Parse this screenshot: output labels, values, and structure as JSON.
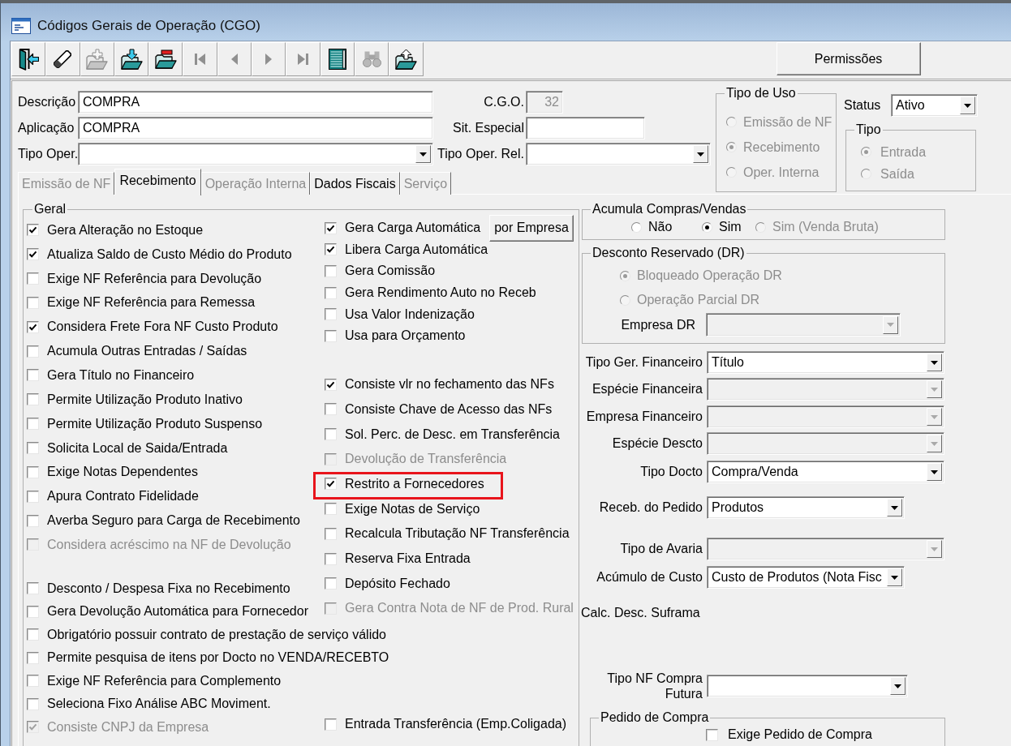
{
  "window": {
    "title": "Códigos Gerais de Operação (CGO)"
  },
  "toolbar": [
    {
      "kind": "exit",
      "disabled": false
    },
    {
      "kind": "eraser",
      "disabled": false
    },
    {
      "kind": "add",
      "disabled": true
    },
    {
      "kind": "import",
      "disabled": false
    },
    {
      "kind": "remove",
      "disabled": false
    },
    {
      "kind": "first",
      "disabled": true
    },
    {
      "kind": "previous",
      "disabled": true
    },
    {
      "kind": "next",
      "disabled": true
    },
    {
      "kind": "last",
      "disabled": true
    },
    {
      "kind": "grid",
      "disabled": false
    },
    {
      "kind": "search",
      "disabled": true
    },
    {
      "kind": "export",
      "disabled": false
    }
  ],
  "permissions_button": "Permissões",
  "header": {
    "rows": [
      [
        {
          "label": "Descrição",
          "kind": "text",
          "value": "COMPRA",
          "disabled": false
        },
        {
          "label": "C.G.O.",
          "kind": "text",
          "value": "32",
          "disabled": true
        }
      ],
      [
        {
          "label": "Aplicação",
          "kind": "text",
          "value": "COMPRA",
          "disabled": false
        },
        {
          "label": "Sit. Especial",
          "kind": "text",
          "disabled": false
        }
      ],
      [
        {
          "label": "Tipo Oper.",
          "kind": "combo",
          "disabled": false
        },
        {
          "label": "Tipo Oper. Rel.",
          "kind": "combo",
          "disabled": false
        }
      ]
    ]
  },
  "tipo_de_uso": {
    "title": "Tipo de Uso",
    "options": [
      {
        "label": "Emissão de NF",
        "selected": false,
        "disabled": true
      },
      {
        "label": "Recebimento",
        "selected": true,
        "disabled": true
      },
      {
        "label": "Oper. Interna",
        "selected": false,
        "disabled": true
      }
    ]
  },
  "status": {
    "label": "Status",
    "value": "Ativo"
  },
  "tipo": {
    "title": "Tipo",
    "options": [
      {
        "label": "Entrada",
        "selected": true,
        "disabled": true
      },
      {
        "label": "Saída",
        "selected": false,
        "disabled": true
      }
    ]
  },
  "tabs": [
    {
      "label": "Emissão de NF",
      "selected": false,
      "disabled": true
    },
    {
      "label": "Recebimento",
      "selected": true,
      "disabled": false
    },
    {
      "label": "Operação Interna",
      "selected": false,
      "disabled": true
    },
    {
      "label": "Dados Fiscais",
      "selected": false,
      "disabled": false
    },
    {
      "label": "Serviço",
      "selected": false,
      "disabled": true
    }
  ],
  "geral": {
    "title": "Geral",
    "columns": [
      {
        "groups": [
          [
            {
              "label": "Gera Alteração no Estoque",
              "checked": true,
              "disabled": false,
              "highlighted": false
            },
            {
              "label": "Atualiza Saldo de Custo Médio do Produto",
              "checked": true,
              "disabled": false,
              "highlighted": false
            },
            {
              "label": "Exige NF Referência para Devolução",
              "checked": false,
              "disabled": false,
              "highlighted": false
            },
            {
              "label": "Exige NF Referência para Remessa",
              "checked": false,
              "disabled": false,
              "highlighted": false
            },
            {
              "label": "Considera Frete Fora NF Custo Produto",
              "checked": true,
              "disabled": false,
              "highlighted": false
            },
            {
              "label": "Acumula Outras Entradas / Saídas",
              "checked": false,
              "disabled": false,
              "highlighted": false
            },
            {
              "label": "Gera Título no Financeiro",
              "checked": false,
              "disabled": false,
              "highlighted": false
            },
            {
              "label": "Permite Utilização Produto Inativo",
              "checked": false,
              "disabled": false,
              "highlighted": false
            },
            {
              "label": "Permite Utilização Produto Suspenso",
              "checked": false,
              "disabled": false,
              "highlighted": false
            },
            {
              "label": "Solicita Local de Saida/Entrada",
              "checked": false,
              "disabled": false,
              "highlighted": false
            },
            {
              "label": "Exige Notas Dependentes",
              "checked": false,
              "disabled": false,
              "highlighted": false
            },
            {
              "label": "Apura Contrato Fidelidade",
              "checked": false,
              "disabled": false,
              "highlighted": false
            },
            {
              "label": "Averba Seguro para Carga de Recebimento",
              "checked": false,
              "disabled": false,
              "highlighted": false
            },
            {
              "label": "Considera acréscimo na NF de Devolução",
              "checked": false,
              "disabled": true,
              "highlighted": false
            }
          ],
          [
            {
              "label": "Desconto / Despesa Fixa no Recebimento",
              "checked": false,
              "disabled": false,
              "highlighted": false
            },
            {
              "label": "Gera Devolução Automática para Fornecedor",
              "checked": false,
              "disabled": false,
              "highlighted": false
            },
            {
              "label": "Obrigatório possuir contrato de prestação de serviço válido",
              "checked": false,
              "disabled": false,
              "highlighted": false
            },
            {
              "label": "Permite pesquisa de itens por Docto no VENDA/RECEBTO",
              "checked": false,
              "disabled": false,
              "highlighted": false
            },
            {
              "label": "Exige NF Referência para Complemento",
              "checked": false,
              "disabled": false,
              "highlighted": false
            },
            {
              "label": "Seleciona Fixo Análise ABC Moviment.",
              "checked": false,
              "disabled": false,
              "highlighted": false
            },
            {
              "label": "Consiste CNPJ da Empresa",
              "checked": true,
              "disabled": true,
              "highlighted": false
            }
          ]
        ]
      },
      {
        "groups": [
          [
            {
              "label": "Gera Carga Automática",
              "checked": true,
              "disabled": false,
              "highlighted": false,
              "button": "por Empresa"
            },
            {
              "label": "Libera Carga Automática",
              "checked": true,
              "disabled": false,
              "highlighted": false
            },
            {
              "label": "Gera Comissão",
              "checked": false,
              "disabled": false,
              "highlighted": false
            },
            {
              "label": "Gera Rendimento Auto no Receb",
              "checked": false,
              "disabled": false,
              "highlighted": false
            },
            {
              "label": "Usa Valor Indenização",
              "checked": false,
              "disabled": false,
              "highlighted": false
            },
            {
              "label": "Usa para Orçamento",
              "checked": false,
              "disabled": false,
              "highlighted": false
            }
          ],
          [
            {
              "label": "Consiste vlr no fechamento das NFs",
              "checked": true,
              "disabled": false,
              "highlighted": false
            },
            {
              "label": "Consiste Chave de Acesso das NFs",
              "checked": false,
              "disabled": false,
              "highlighted": false
            },
            {
              "label": "Sol. Perc. de Desc. em Transferência",
              "checked": false,
              "disabled": false,
              "highlighted": false
            },
            {
              "label": "Devolução de Transferência",
              "checked": false,
              "disabled": true,
              "highlighted": false
            },
            {
              "label": "Restrito a Fornecedores",
              "checked": true,
              "disabled": false,
              "highlighted": true
            },
            {
              "label": "Exige Notas de Serviço",
              "checked": false,
              "disabled": false,
              "highlighted": false
            },
            {
              "label": "Recalcula Tributação NF Transferência",
              "checked": false,
              "disabled": false,
              "highlighted": false
            },
            {
              "label": "Reserva Fixa Entrada",
              "checked": false,
              "disabled": false,
              "highlighted": false
            },
            {
              "label": "Depósito Fechado",
              "checked": false,
              "disabled": false,
              "highlighted": false
            },
            {
              "label": "Gera Contra Nota de NF de Prod. Rural",
              "checked": false,
              "disabled": true,
              "highlighted": false
            }
          ],
          [
            {
              "label": "Entrada Transferência (Emp.Coligada)",
              "checked": false,
              "disabled": false,
              "highlighted": false
            }
          ]
        ]
      }
    ]
  },
  "acumula_compras_vendas": {
    "title": "Acumula Compras/Vendas",
    "options": [
      {
        "label": "Não",
        "selected": false,
        "disabled": false
      },
      {
        "label": "Sim",
        "selected": true,
        "disabled": false
      },
      {
        "label": "Sim (Venda Bruta)",
        "selected": false,
        "disabled": true
      }
    ]
  },
  "desconto_reservado": {
    "title": "Desconto Reservado (DR)",
    "options": [
      {
        "label": "Bloqueado Operação DR",
        "selected": true,
        "disabled": true
      },
      {
        "label": "Operação Parcial DR",
        "selected": false,
        "disabled": true
      }
    ],
    "field": {
      "label": "Empresa DR",
      "kind": "combo",
      "disabled": true
    }
  },
  "fields": [
    {
      "label": "Tipo Ger. Financeiro",
      "kind": "combo",
      "value": "Título",
      "disabled": false
    },
    {
      "label": "Espécie Financeira",
      "kind": "combo",
      "disabled": true
    },
    {
      "label": "Empresa Financeiro",
      "kind": "combo",
      "disabled": true
    },
    {
      "label": "Espécie Descto",
      "kind": "combo",
      "disabled": true
    },
    {
      "label": "Tipo Docto",
      "kind": "combo",
      "value": "Compra/Venda",
      "disabled": false
    },
    {
      "label": "Receb. do Pedido",
      "kind": "combo",
      "value": "Produtos",
      "disabled": false
    },
    {
      "label": "Tipo de Avaria",
      "kind": "combo",
      "disabled": true
    },
    {
      "label": "Acúmulo de Custo",
      "kind": "combo",
      "value": "Custo de Produtos (Nota Fisc",
      "disabled": false
    },
    {
      "label": "Calc. Desc. Suframa",
      "kind": "label"
    },
    {
      "label": "Tipo NF Compra Futura",
      "kind": "combo",
      "disabled": false
    }
  ],
  "pedido_de_compra": {
    "title": "Pedido de Compra",
    "items": [
      {
        "label": "Exige Pedido de Compra",
        "checked": false,
        "disabled": false
      }
    ]
  }
}
